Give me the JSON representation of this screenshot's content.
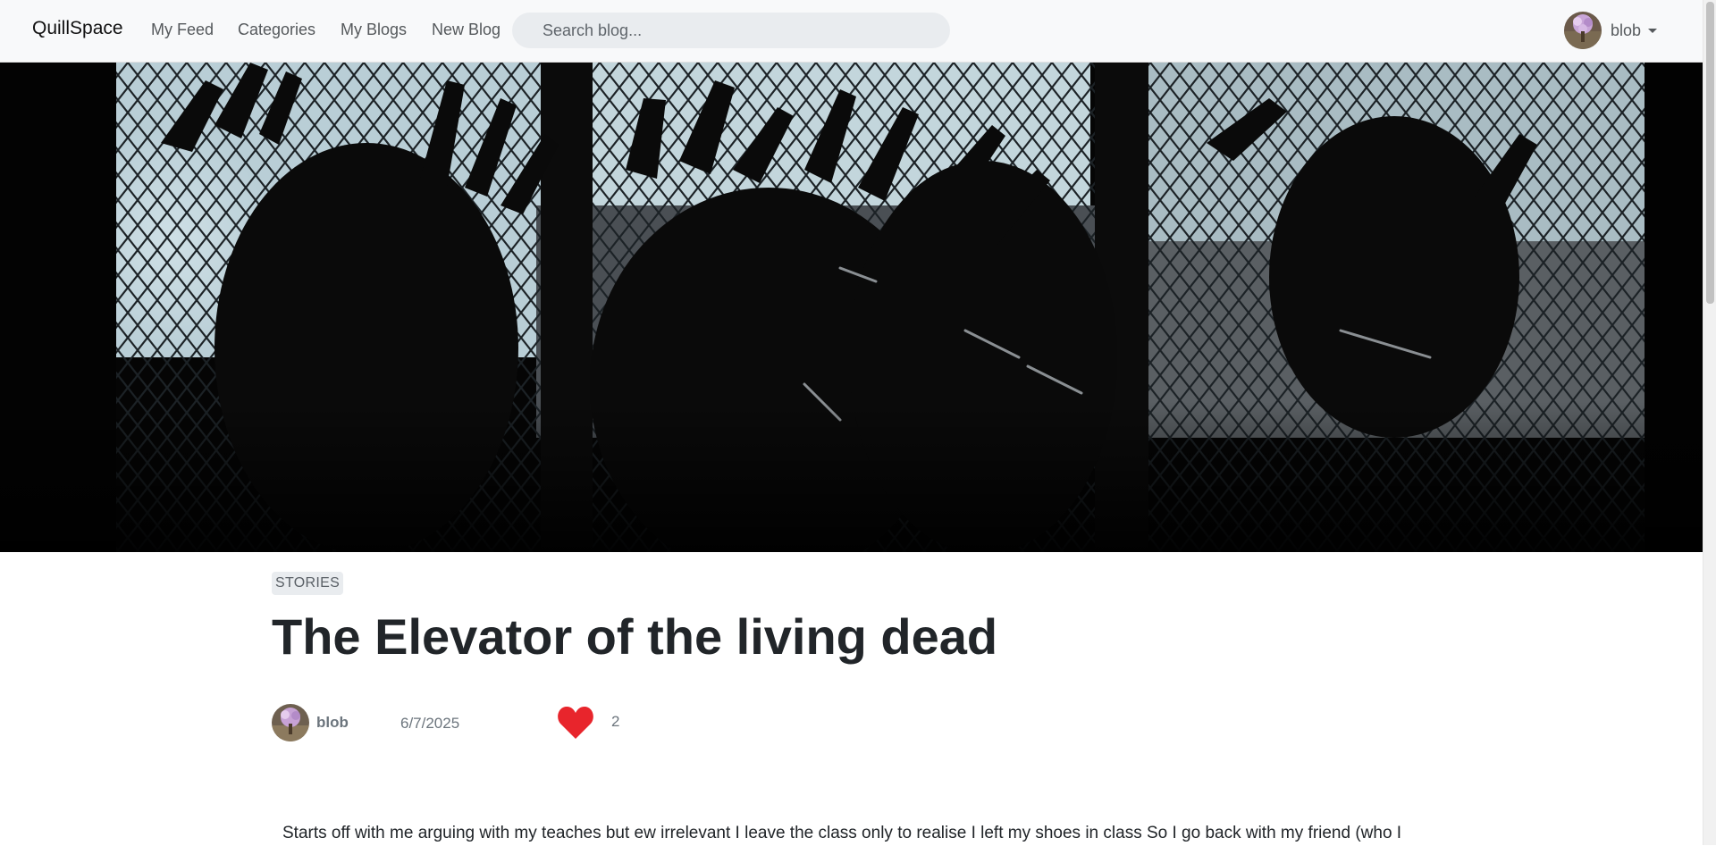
{
  "navbar": {
    "brand": "QuillSpace",
    "links": [
      "My Feed",
      "Categories",
      "My Blogs",
      "New Blog"
    ],
    "search_placeholder": "Search blog...",
    "user": "blob"
  },
  "post": {
    "category": "STORIES",
    "title": "The Elevator of the living dead",
    "author": "blob",
    "date": "6/7/2025",
    "likes": "2",
    "body": "Starts off with me arguing with my teaches but ew irrelevant I leave the class only to realise I left my shoes in class So I go back with my friend (who I"
  },
  "colors": {
    "navbar_bg": "#f8f9fa",
    "heart": "#e8252c",
    "badge_bg": "#e9ecef"
  },
  "icons": {
    "like": "heart-icon",
    "menu": "caret-down-icon"
  }
}
